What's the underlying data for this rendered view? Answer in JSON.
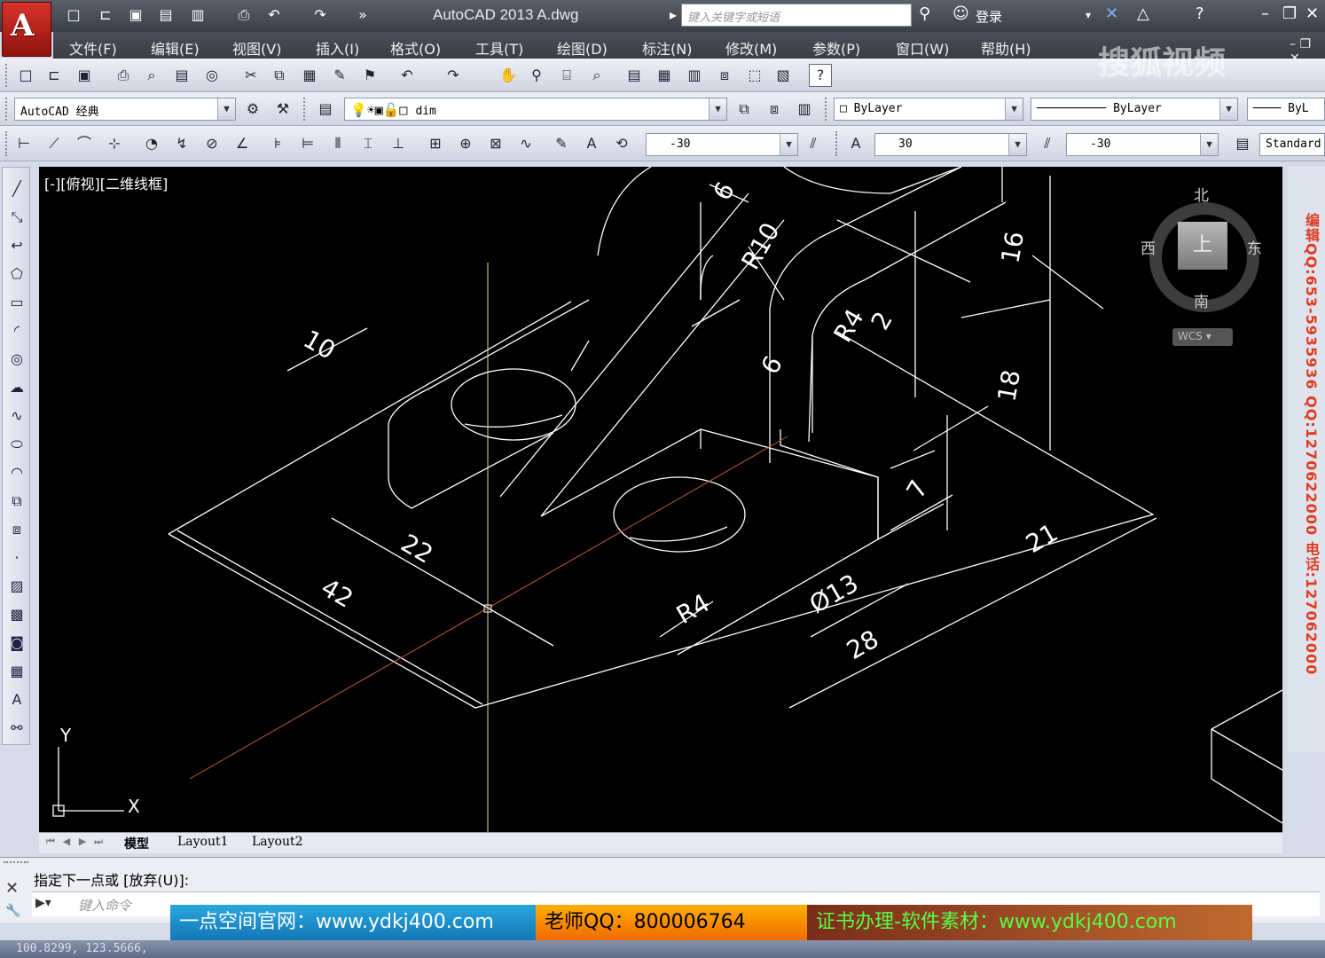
{
  "app": {
    "logo_letter": "A",
    "title": "AutoCAD 2013    A.dwg",
    "search_placeholder": "键入关键字或短语",
    "login_label": "登录",
    "watermark_brand": "搜狐视频"
  },
  "menu": [
    "文件(F)",
    "编辑(E)",
    "视图(V)",
    "插入(I)",
    "格式(O)",
    "工具(T)",
    "绘图(D)",
    "标注(N)",
    "修改(M)",
    "参数(P)",
    "窗口(W)",
    "帮助(H)"
  ],
  "toolbars": {
    "workspace": "AutoCAD 经典",
    "layer": "dim",
    "color": "ByLayer",
    "linetype": "ByLayer",
    "lineweight": "ByL",
    "dim_angle_1": "-30",
    "text_angle": "30",
    "dim_angle_2": "-30",
    "style": "Standard"
  },
  "viewport": {
    "label": "[-][俯视][二维线框]",
    "compass": {
      "north": "北",
      "south": "南",
      "east": "东",
      "west": "西",
      "top": "上"
    },
    "wcs": "WCS",
    "ucs": {
      "y": "Y",
      "x": "X"
    }
  },
  "dimensions": [
    "6",
    "R10",
    "16",
    "R4",
    "2",
    "6",
    "18",
    "10",
    "7",
    "22",
    "42",
    "R4",
    "Ø13",
    "28",
    "21"
  ],
  "tabs": [
    "模型",
    "Layout1",
    "Layout2"
  ],
  "command": {
    "history": "指定下一点或 [放弃(U)]:",
    "placeholder": "键入命令"
  },
  "status": {
    "coords": "100.8299, 123.5666,"
  },
  "banner": {
    "site": "一点空间官网：www.ydkj400.com",
    "qq": "老师QQ：800006764",
    "service": "证书办理-软件素材：www.ydkj400.com"
  },
  "side_watermark": "编辑QQ:653-5935936 QQ:1270622000 电话:127062000"
}
